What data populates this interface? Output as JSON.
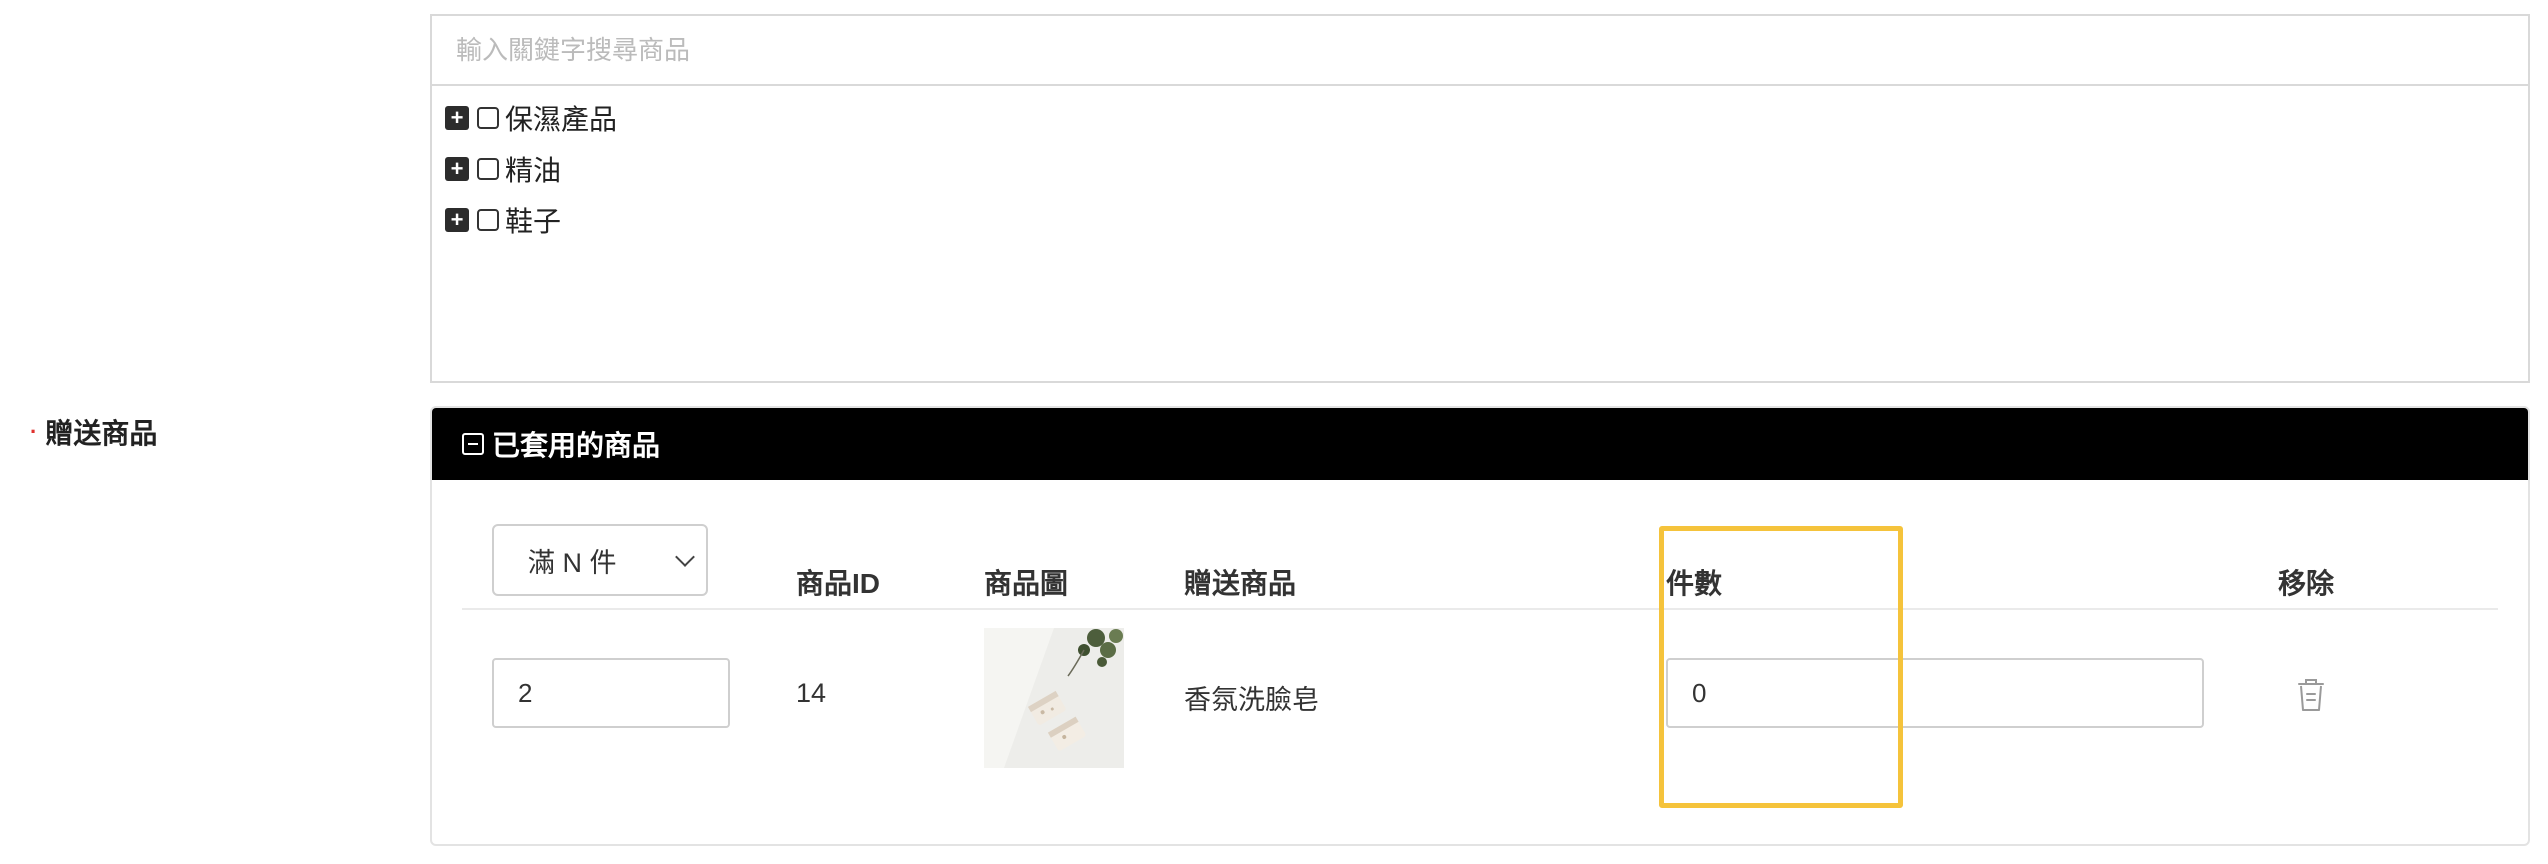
{
  "search": {
    "placeholder": "輸入關鍵字搜尋商品"
  },
  "tree": {
    "items": [
      {
        "label": "保濕產品",
        "expand_icon": "plus-square-icon"
      },
      {
        "label": "精油",
        "expand_icon": "plus-square-icon"
      },
      {
        "label": "鞋子",
        "expand_icon": "plus-square-icon"
      }
    ]
  },
  "gift_field": {
    "label": "贈送商品",
    "required": true,
    "required_color": "#e0322f"
  },
  "applied": {
    "title": "已套用的商品",
    "collapse_icon": "minus-square-icon",
    "header_bg": "#000000",
    "condition_select": {
      "selected": "滿 N 件"
    },
    "columns": {
      "product_id": "商品ID",
      "product_image": "商品圖",
      "gift_product": "贈送商品",
      "quantity": "件數",
      "remove": "移除"
    },
    "rows": [
      {
        "threshold": "2",
        "product_id": "14",
        "product_image": "soap-product-thumbnail",
        "gift_product": "香氛洗臉皂",
        "quantity": "0",
        "remove_icon": "trash-icon"
      }
    ]
  },
  "highlight": {
    "color": "#f5c33b",
    "target": "件數"
  }
}
